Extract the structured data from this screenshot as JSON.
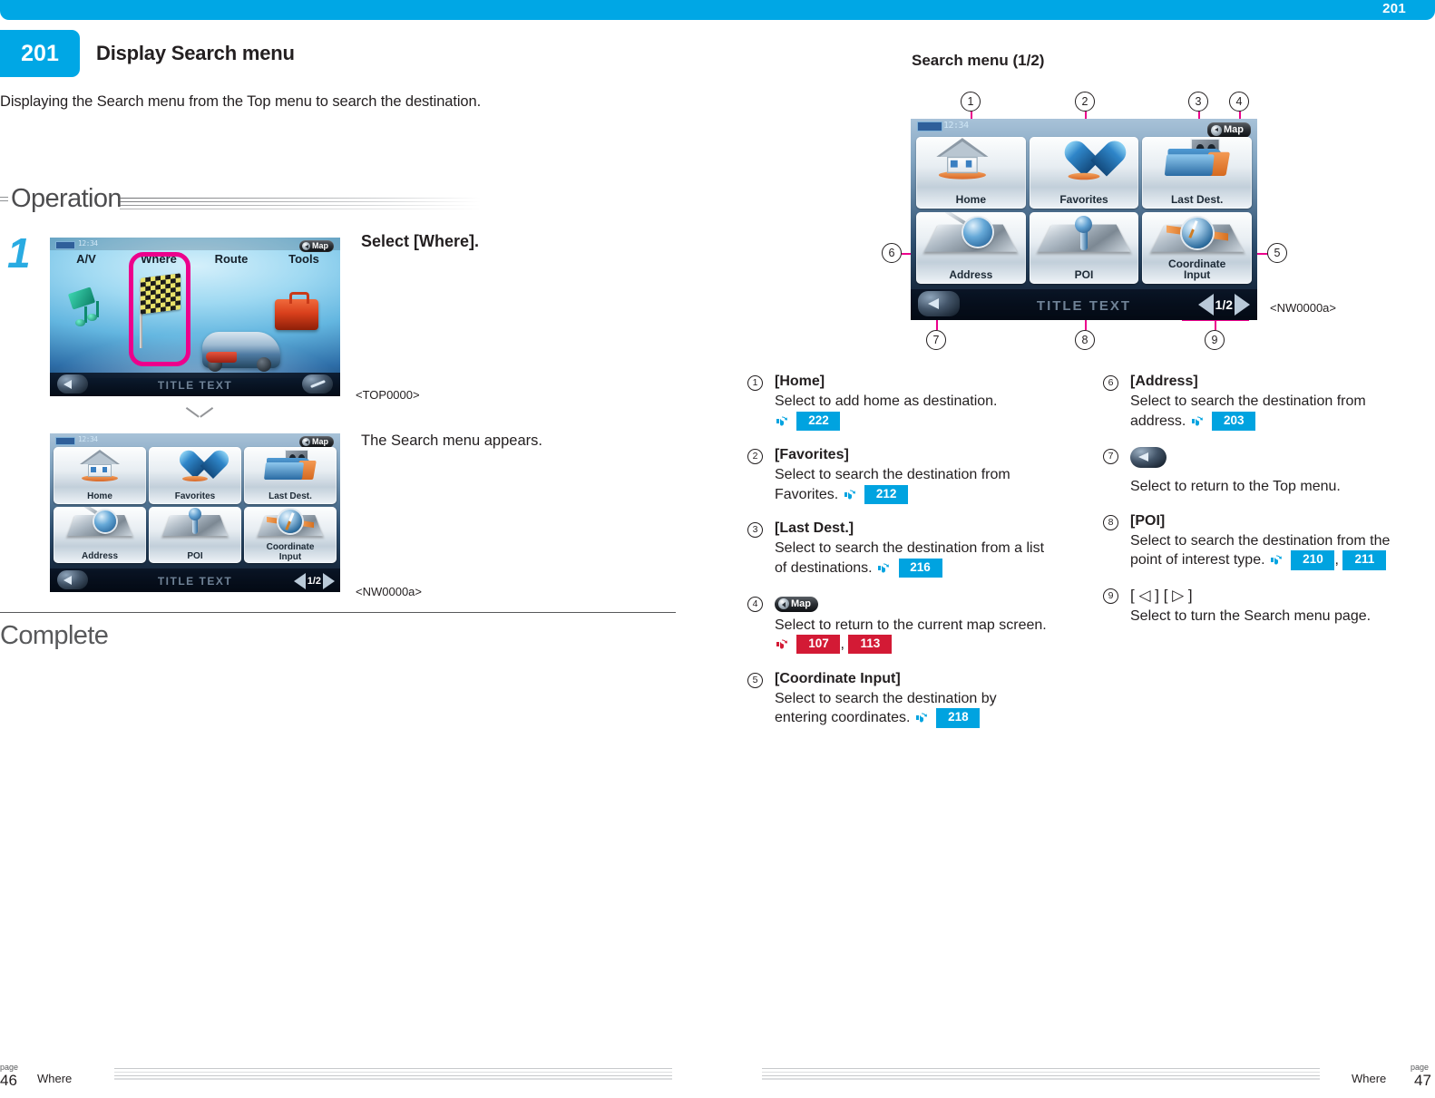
{
  "top_bar": {
    "page_number": "201"
  },
  "header": {
    "section_number": "201",
    "title": "Display Search menu",
    "intro": "Displaying the Search menu from the Top menu to search the destination."
  },
  "operation": {
    "label": "Operation",
    "step_number": "1",
    "instruction": "Select [Where].",
    "result_text": "The Search menu appears.",
    "top_screen_code": "<TOP0000>",
    "search_screen_code": "<NW0000a>"
  },
  "complete": {
    "label": "Complete"
  },
  "top_menu_screen": {
    "clock": "12:34",
    "map_button": "Map",
    "tabs": [
      "A/V",
      "Where",
      "Route",
      "Tools"
    ],
    "highlighted_tab": "Where",
    "title_text": "TITLE TEXT"
  },
  "search_menu_screen": {
    "clock": "12:34",
    "map_button": "Map",
    "title_text": "TITLE TEXT",
    "page_indicator": "1/2",
    "tiles": [
      {
        "label": "Home",
        "icon": "house-icon"
      },
      {
        "label": "Favorites",
        "icon": "heart-icon"
      },
      {
        "label": "Last Dest.",
        "icon": "folder-photos-icon"
      },
      {
        "label": "Address",
        "icon": "magnifier-map-icon"
      },
      {
        "label": "POI",
        "icon": "pin-map-icon"
      },
      {
        "label": "Coordinate\nInput",
        "icon": "compass-map-icon"
      }
    ],
    "tile_labels": {
      "home": "Home",
      "favorites": "Favorites",
      "last_dest": "Last Dest.",
      "address": "Address",
      "poi": "POI",
      "coordinate_input_line1": "Coordinate",
      "coordinate_input_line2": "Input"
    }
  },
  "diagram": {
    "caption": "Search menu (1/2)",
    "screen_code": "<NW0000a>",
    "callouts": [
      "1",
      "2",
      "3",
      "4",
      "5",
      "6",
      "7",
      "8",
      "9"
    ]
  },
  "legend_left": [
    {
      "num": "1",
      "title": "[Home]",
      "desc": "Select to add home as destination.",
      "refs": [
        {
          "value": "222",
          "color": "blue"
        }
      ],
      "refs_inline": false
    },
    {
      "num": "2",
      "title": "[Favorites]",
      "desc_line1": "Select to search the destination from",
      "desc_line2": "Favorites.",
      "refs": [
        {
          "value": "212",
          "color": "blue"
        }
      ],
      "refs_inline": true
    },
    {
      "num": "3",
      "title": "[Last Dest.]",
      "desc_line1": "Select to search the destination from a list",
      "desc_line2": "of destinations.",
      "refs": [
        {
          "value": "216",
          "color": "blue"
        }
      ],
      "refs_inline": true
    },
    {
      "num": "4",
      "title_icon": "map-button-icon",
      "title_icon_label": "Map",
      "desc": "Select to return to the current map screen.",
      "refs": [
        {
          "value": "107",
          "color": "red"
        },
        {
          "value": "113",
          "color": "red"
        }
      ],
      "refs_inline": false
    },
    {
      "num": "5",
      "title": "[Coordinate Input]",
      "desc_line1": "Select to search the destination by",
      "desc_line2": "entering coordinates.",
      "refs": [
        {
          "value": "218",
          "color": "blue"
        }
      ],
      "refs_inline": true
    }
  ],
  "legend_right": [
    {
      "num": "6",
      "title": "[Address]",
      "desc_line1": "Select to search the destination from",
      "desc_line2": "address.",
      "refs": [
        {
          "value": "203",
          "color": "blue"
        }
      ],
      "refs_inline": true
    },
    {
      "num": "7",
      "title_icon": "back-button-icon",
      "desc": "Select to return to the Top menu.",
      "refs": [],
      "refs_inline": false
    },
    {
      "num": "8",
      "title": "[POI]",
      "desc_line1": "Select to search the destination from the",
      "desc_line2": "point of interest type.",
      "refs": [
        {
          "value": "210",
          "color": "blue"
        },
        {
          "value": "211",
          "color": "blue"
        }
      ],
      "refs_inline": true
    },
    {
      "num": "9",
      "title": "[ ◁ ] [ ▷ ]",
      "desc": "Select to turn the Search menu page.",
      "refs": [],
      "refs_inline": false
    }
  ],
  "footer_left": {
    "page_word": "page",
    "page_number": "46",
    "chapter": "Where"
  },
  "footer_right": {
    "page_word": "page",
    "page_number": "47",
    "chapter": "Where"
  },
  "colors": {
    "accent_blue": "#00a7e5",
    "badge_blue": "#00a3e0",
    "badge_red": "#d31a35",
    "highlight_magenta": "#ec008c",
    "step_number_blue": "#29abe2",
    "text": "#231f20"
  }
}
